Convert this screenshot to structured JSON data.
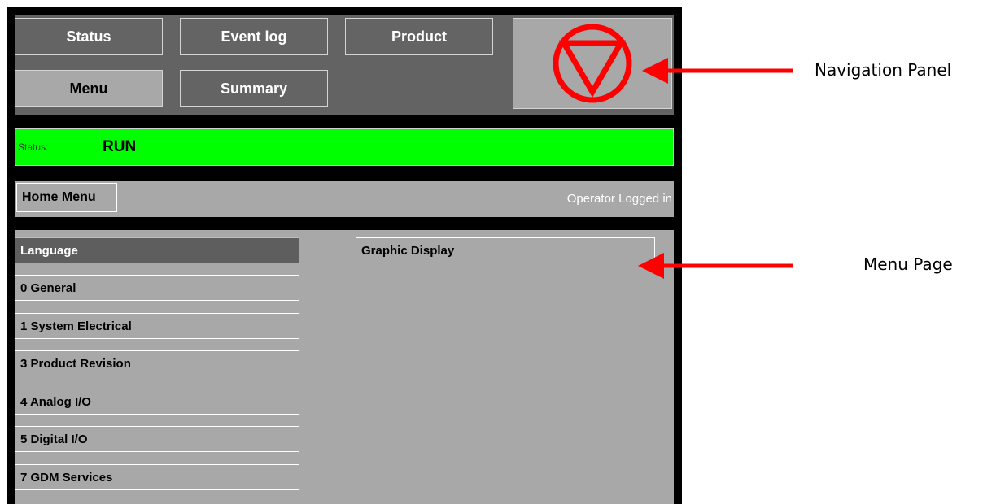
{
  "nav": {
    "status_label": "Status",
    "event_log_label": "Event log",
    "product_label": "Product",
    "menu_label": "Menu",
    "summary_label": "Summary",
    "stop_icon": "stop-triangle-icon",
    "stop_color": "#ff0000"
  },
  "status_bar": {
    "label": "Status:",
    "value": "RUN",
    "color": "#00ff00"
  },
  "toolbar": {
    "home_label": "Home Menu",
    "login_text": "Operator Logged in"
  },
  "menu": {
    "left_items": [
      {
        "label": "Language",
        "selected": true
      },
      {
        "label": "0 General"
      },
      {
        "label": "1 System Electrical"
      },
      {
        "label": "3 Product Revision"
      },
      {
        "label": "4 Analog I/O"
      },
      {
        "label": "5 Digital I/O"
      },
      {
        "label": "7 GDM Services"
      }
    ],
    "right_items": [
      {
        "label": "Graphic Display"
      }
    ]
  },
  "annotations": {
    "navigation_panel": "Navigation Panel",
    "menu_page": "Menu Page",
    "arrow_color": "#ff0000"
  }
}
